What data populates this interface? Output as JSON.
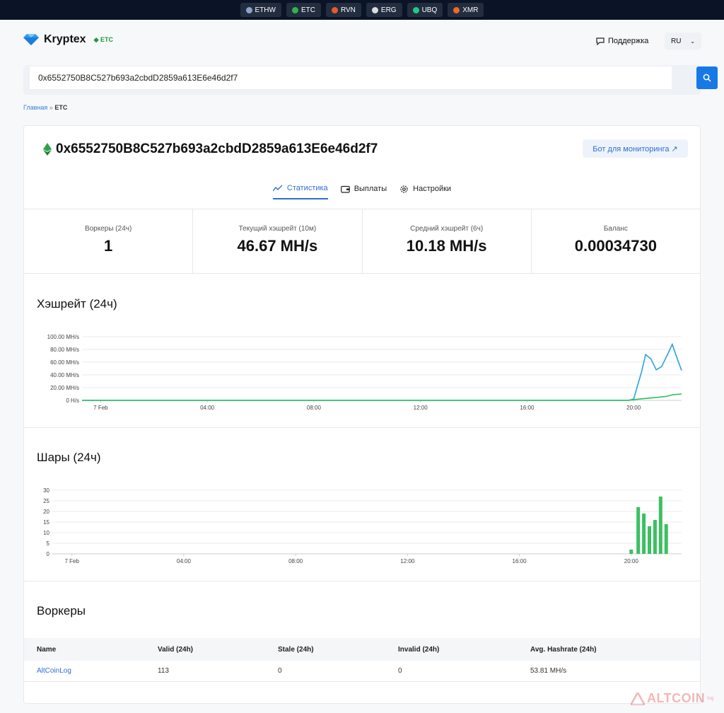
{
  "coins": [
    {
      "name": "ETHW",
      "color": "#8fa3c9"
    },
    {
      "name": "ETC",
      "color": "#33b24a"
    },
    {
      "name": "RVN",
      "color": "#e65a2c"
    },
    {
      "name": "ERG",
      "color": "#dddddd"
    },
    {
      "name": "UBQ",
      "color": "#26c686"
    },
    {
      "name": "XMR",
      "color": "#f26822"
    }
  ],
  "brand": {
    "name": "Kryptex",
    "tag": "ETC"
  },
  "header": {
    "support": "Поддержка",
    "lang": "RU"
  },
  "search": {
    "value": "0x6552750B8C527b693a2cbdD2859a613E6e46d2f7"
  },
  "breadcrumb": {
    "home": "Главная",
    "sep": "»",
    "current": "ETC"
  },
  "wallet": {
    "address": "0x6552750B8C527b693a2cbdD2859a613E6e46d2f7",
    "bot_button": "Бот для мониторинга ↗"
  },
  "tabs": [
    {
      "label": "Статистика",
      "active": true
    },
    {
      "label": "Выплаты",
      "active": false
    },
    {
      "label": "Настройки",
      "active": false
    }
  ],
  "stats": [
    {
      "label": "Воркеры (24ч)",
      "value": "1"
    },
    {
      "label": "Текущий хэшрейт (10м)",
      "value": "46.67 MH/s"
    },
    {
      "label": "Средний хэшрейт (6ч)",
      "value": "10.18 MH/s"
    },
    {
      "label": "Баланс",
      "value": "0.00034730"
    }
  ],
  "hashrate_title": "Хэшрейт (24ч)",
  "shares_title": "Шары (24ч)",
  "workers_title": "Воркеры",
  "chart_data": [
    {
      "type": "line",
      "title": "Хэшрейт (24ч)",
      "x_ticks": [
        "7 Feb",
        "04:00",
        "08:00",
        "12:00",
        "16:00",
        "20:00"
      ],
      "y_ticks": [
        "0 H/s",
        "20.00 MH/s",
        "40.00 MH/s",
        "60.00 MH/s",
        "80.00 MH/s",
        "100.00 MH/s"
      ],
      "ylim": [
        0,
        100
      ],
      "grid": true,
      "series": [
        {
          "color": "#2aa3de",
          "points": [
            [
              0,
              0
            ],
            [
              20.5,
              0
            ],
            [
              20.7,
              2
            ],
            [
              21.0,
              45
            ],
            [
              21.15,
              72
            ],
            [
              21.35,
              65
            ],
            [
              21.55,
              48
            ],
            [
              21.75,
              53
            ],
            [
              21.95,
              70
            ],
            [
              22.15,
              88
            ],
            [
              22.35,
              64
            ],
            [
              22.5,
              47
            ]
          ]
        },
        {
          "color": "#2fbf5a",
          "points": [
            [
              0,
              0
            ],
            [
              20.5,
              0
            ],
            [
              20.9,
              2
            ],
            [
              21.4,
              4
            ],
            [
              21.9,
              6
            ],
            [
              22.2,
              9
            ],
            [
              22.5,
              10
            ]
          ]
        }
      ]
    },
    {
      "type": "bar",
      "title": "Шары (24ч)",
      "x_ticks": [
        "7 Feb",
        "04:00",
        "08:00",
        "12:00",
        "16:00",
        "20:00"
      ],
      "y_ticks": [
        "0",
        "5",
        "10",
        "15",
        "20",
        "25",
        "30"
      ],
      "ylim": [
        0,
        30
      ],
      "grid": true,
      "color": "#3dbf62",
      "bars": [
        [
          20.7,
          2
        ],
        [
          20.95,
          22
        ],
        [
          21.15,
          19
        ],
        [
          21.35,
          13
        ],
        [
          21.55,
          16
        ],
        [
          21.75,
          27
        ],
        [
          21.95,
          14
        ]
      ]
    }
  ],
  "workers_table": {
    "headers": [
      "Name",
      "Valid (24h)",
      "Stale (24h)",
      "Invalid (24h)",
      "Avg. Hashrate (24h)"
    ],
    "rows": [
      {
        "name": "AltCoinLog",
        "valid": "113",
        "stale": "0",
        "invalid": "0",
        "hashrate": "53.81 MH/s"
      }
    ]
  },
  "watermark": {
    "text": "ALTCOIN",
    "suffix": "log"
  }
}
